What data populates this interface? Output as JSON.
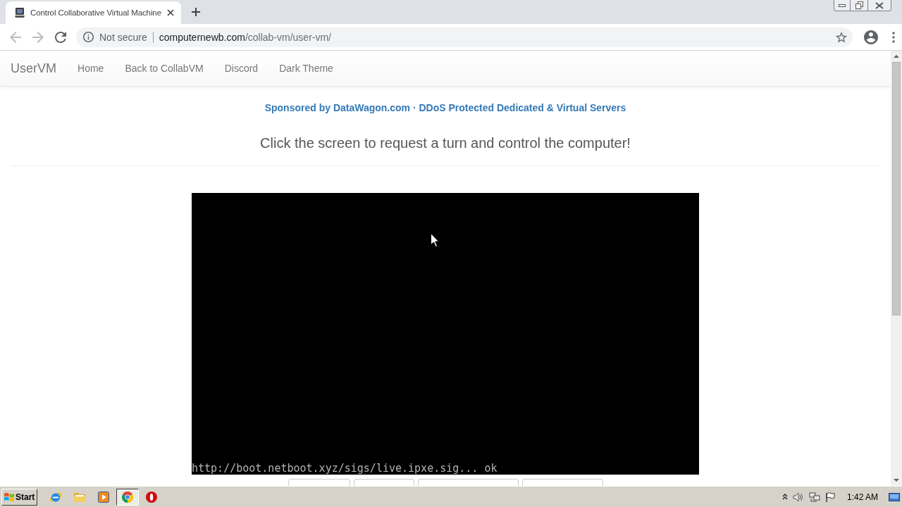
{
  "browser": {
    "tabs": [
      {
        "title": "Control Collaborative Virtual Machine",
        "selected": true
      }
    ],
    "toolbar": {
      "back": {
        "disabled": true
      },
      "forward": {
        "disabled": true
      },
      "security_label": "Not secure",
      "url_host": "computernewb.com",
      "url_path": "/collab-vm/user-vm/"
    }
  },
  "navbar": {
    "brand": "UserVM",
    "links": [
      "Home",
      "Back to CollabVM",
      "Discord",
      "Dark Theme"
    ]
  },
  "sponsor": "Sponsored by DataWagon.com · DDoS Protected Dedicated & Virtual Servers",
  "heading": "Click the screen to request a turn and control the computer!",
  "vm": {
    "console_line": "http://boot.netboot.xyz/sigs/live.ipxe.sig... ok",
    "vm_buttons": [
      {
        "kind": "button"
      },
      {
        "kind": "button"
      },
      {
        "kind": "button"
      },
      {
        "kind": "button"
      }
    ]
  },
  "taskbar": {
    "start_label": "Start",
    "apps": [
      {
        "kind": "globe",
        "selected": false
      },
      {
        "kind": "folder",
        "selected": false
      },
      {
        "kind": "player",
        "selected": false
      },
      {
        "kind": "wheel",
        "selected": true
      },
      {
        "kind": "ring",
        "selected": false
      }
    ],
    "clock": "1:42 AM"
  }
}
